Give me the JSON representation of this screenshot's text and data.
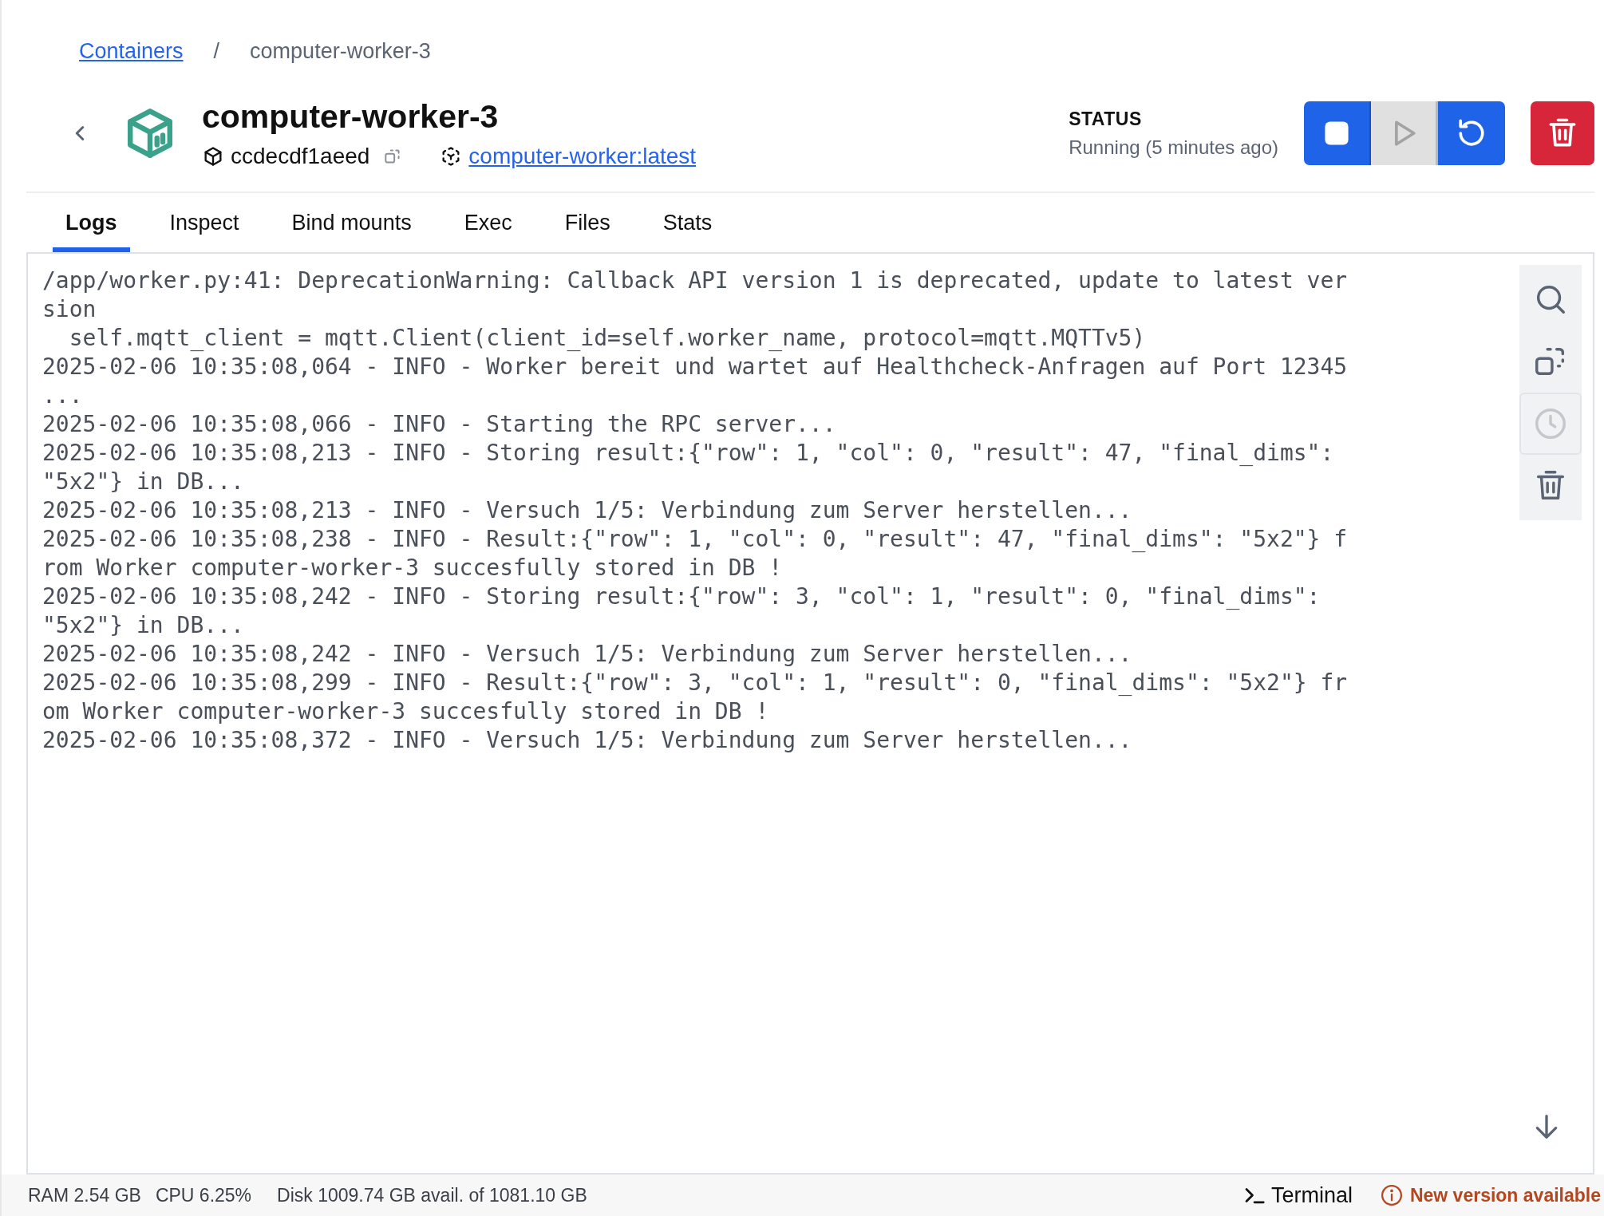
{
  "breadcrumb": {
    "link": "Containers",
    "separator": "/",
    "current": "computer-worker-3"
  },
  "header": {
    "title": "computer-worker-3",
    "id": "ccdecdf1aeed",
    "image": "computer-worker:latest"
  },
  "status": {
    "label": "STATUS",
    "value": "Running (5 minutes ago)"
  },
  "actions": [
    {
      "kind": "stop",
      "disabled": false
    },
    {
      "kind": "start",
      "disabled": true
    },
    {
      "kind": "restart",
      "disabled": false
    },
    {
      "kind": "delete",
      "disabled": false
    }
  ],
  "tabs": [
    {
      "label": "Logs",
      "selected": true
    },
    {
      "label": "Inspect",
      "selected": false
    },
    {
      "label": "Bind mounts",
      "selected": false
    },
    {
      "label": "Exec",
      "selected": false
    },
    {
      "label": "Files",
      "selected": false
    },
    {
      "label": "Stats",
      "selected": false
    }
  ],
  "logs": [
    "/app/worker.py:41: DeprecationWarning: Callback API version 1 is deprecated, update to latest version",
    "  self.mqtt_client = mqtt.Client(client_id=self.worker_name, protocol=mqtt.MQTTv5)",
    "2025-02-06 10:35:08,064 - INFO - Worker bereit und wartet auf Healthcheck-Anfragen auf Port 12345 ...",
    "2025-02-06 10:35:08,066 - INFO - Starting the RPC server...",
    "2025-02-06 10:35:08,213 - INFO - Storing result:{\"row\": 1, \"col\": 0, \"result\": 47, \"final_dims\": \"5x2\"} in DB...",
    "2025-02-06 10:35:08,213 - INFO - Versuch 1/5: Verbindung zum Server herstellen...",
    "2025-02-06 10:35:08,238 - INFO - Result:{\"row\": 1, \"col\": 0, \"result\": 47, \"final_dims\": \"5x2\"} from Worker computer-worker-3 succesfully stored in DB !",
    "2025-02-06 10:35:08,242 - INFO - Storing result:{\"row\": 3, \"col\": 1, \"result\": 0, \"final_dims\": \"5x2\"} in DB...",
    "2025-02-06 10:35:08,242 - INFO - Versuch 1/5: Verbindung zum Server herstellen...",
    "2025-02-06 10:35:08,299 - INFO - Result:{\"row\": 3, \"col\": 1, \"result\": 0, \"final_dims\": \"5x2\"} from Worker computer-worker-3 succesfully stored in DB !",
    "2025-02-06 10:35:08,372 - INFO - Versuch 1/5: Verbindung zum Server herstellen..."
  ],
  "log_tools": [
    {
      "kind": "search",
      "disabled": false
    },
    {
      "kind": "copy",
      "disabled": false
    },
    {
      "kind": "timestamps",
      "disabled": true
    },
    {
      "kind": "clear",
      "disabled": false
    }
  ],
  "status_bar": {
    "ram": "RAM 2.54 GB",
    "cpu": "CPU 6.25%",
    "disk": "Disk 1009.74 GB avail. of 1081.10 GB",
    "terminal": "Terminal",
    "update": "New version available"
  }
}
